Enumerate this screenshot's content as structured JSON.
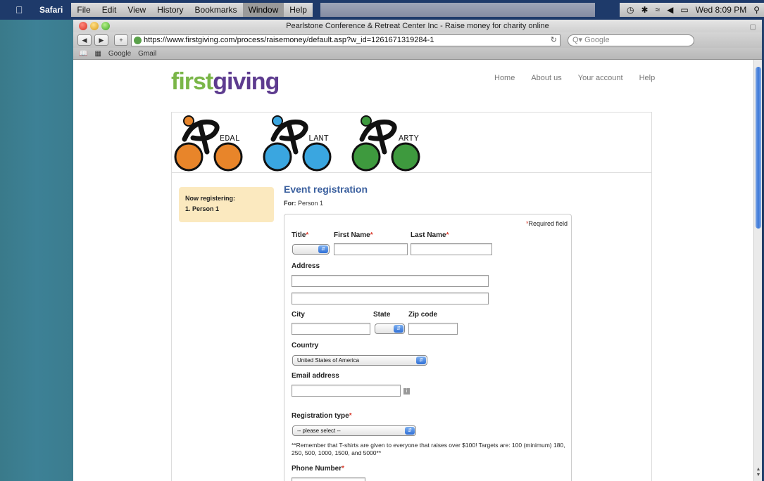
{
  "menubar": {
    "app_name": "Safari",
    "items": [
      "File",
      "Edit",
      "View",
      "History",
      "Bookmarks",
      "Window",
      "Help"
    ],
    "clock": "Wed 8:09 PM"
  },
  "window": {
    "title": "Pearlstone Conference & Retreat Center Inc - Raise money for charity online",
    "url": "https://www.firstgiving.com/process/raisemoney/default.asp?w_id=1261671319284-1",
    "search_placeholder": "Google",
    "bookmarks": [
      "Google",
      "Gmail"
    ]
  },
  "site": {
    "logo_first": "first",
    "logo_giving": "giving",
    "nav": [
      "Home",
      "About us",
      "Your account",
      "Help"
    ],
    "banner_words": [
      "EDAL",
      "LANT",
      "ARTY"
    ]
  },
  "sidebar": {
    "heading": "Now registering:",
    "item": "1. Person 1"
  },
  "form": {
    "title": "Event registration",
    "for_label": "For:",
    "for_value": "Person 1",
    "required_note": "Required field",
    "labels": {
      "title": "Title",
      "first_name": "First Name",
      "last_name": "Last Name",
      "address": "Address",
      "city": "City",
      "state": "State",
      "zip": "Zip code",
      "country": "Country",
      "email": "Email address",
      "registration_type": "Registration type",
      "phone": "Phone Number"
    },
    "country_value": "United States of America",
    "registration_type_value": "-- please select --",
    "note": "**Remember that T-shirts are given to everyone that raises over $100! Targets are: 100 (minimum) 180, 250, 500, 1000, 1500, and 5000**"
  }
}
